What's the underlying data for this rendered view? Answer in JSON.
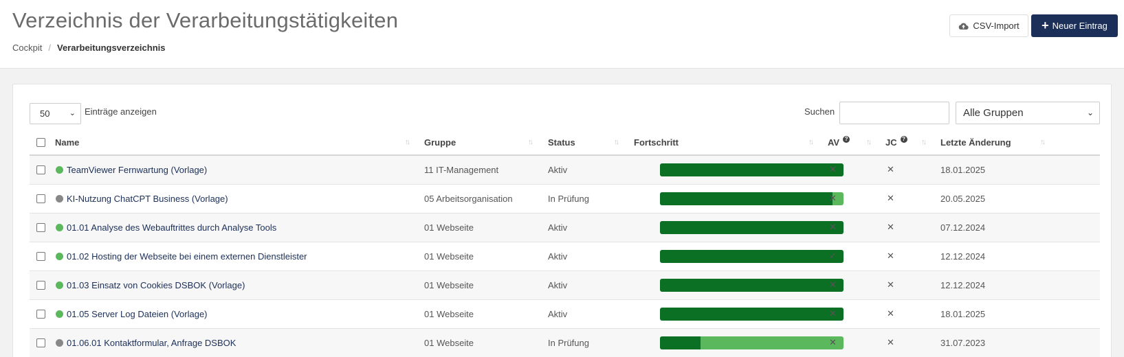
{
  "header": {
    "title": "Verzeichnis der Verarbeitungstätigkeiten",
    "breadcrumb": [
      "Cockpit",
      "Verarbeitungsverzeichnis"
    ],
    "csv_import_label": "CSV-Import",
    "new_entry_label": "Neuer Eintrag"
  },
  "controls": {
    "page_length": "50",
    "page_length_label": "Einträge anzeigen",
    "search_label": "Suchen",
    "search_value": "",
    "group_filter": "Alle Gruppen"
  },
  "columns": [
    "Name",
    "Gruppe",
    "Status",
    "Fortschritt",
    "AV",
    "JC",
    "Letzte Änderung"
  ],
  "colors": {
    "active_dot": "#5cb85c",
    "review_dot": "#888888",
    "progress_done": "#0b7024",
    "progress_rest": "#5cb85c",
    "primary": "#1b2f58"
  },
  "rows": [
    {
      "name": "TeamViewer Fernwartung (Vorlage)",
      "group": "11 IT-Management",
      "status": "Aktiv",
      "status_color": "#5cb85c",
      "progress": 100,
      "av": "✕",
      "jc": "✕",
      "date": "18.01.2025"
    },
    {
      "name": "KI-Nutzung ChatCPT Business (Vorlage)",
      "group": "05 Arbeitsorganisation",
      "status": "In Prüfung",
      "status_color": "#888888",
      "progress": 94,
      "av": "✕",
      "jc": "✕",
      "date": "20.05.2025"
    },
    {
      "name": "01.01 Analyse des Webauftrittes durch Analyse Tools",
      "group": "01 Webseite",
      "status": "Aktiv",
      "status_color": "#5cb85c",
      "progress": 100,
      "av": "✕",
      "jc": "✕",
      "date": "07.12.2024"
    },
    {
      "name": "01.02 Hosting der Webseite bei einem externen Dienstleister",
      "group": "01 Webseite",
      "status": "Aktiv",
      "status_color": "#5cb85c",
      "progress": 100,
      "av": "✓",
      "jc": "✕",
      "date": "12.12.2024"
    },
    {
      "name": "01.03 Einsatz von Cookies DSBOK (Vorlage)",
      "group": "01 Webseite",
      "status": "Aktiv",
      "status_color": "#5cb85c",
      "progress": 100,
      "av": "✕",
      "jc": "✕",
      "date": "12.12.2024"
    },
    {
      "name": "01.05 Server Log Dateien (Vorlage)",
      "group": "01 Webseite",
      "status": "Aktiv",
      "status_color": "#5cb85c",
      "progress": 100,
      "av": "✕",
      "jc": "✕",
      "date": "18.01.2025"
    },
    {
      "name": "01.06.01 Kontaktformular, Anfrage DSBOK",
      "group": "01 Webseite",
      "status": "In Prüfung",
      "status_color": "#888888",
      "progress": 22,
      "av": "✕",
      "jc": "✕",
      "date": "31.07.2023"
    }
  ]
}
